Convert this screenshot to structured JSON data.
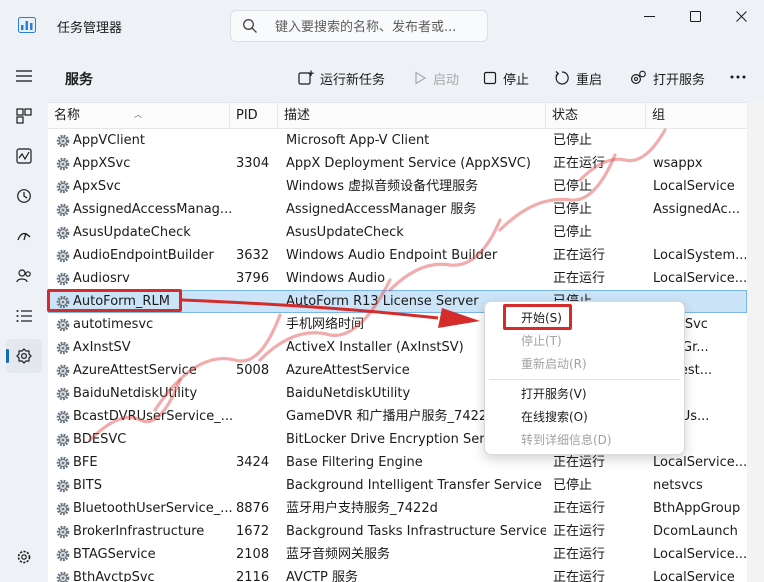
{
  "titlebar": {
    "app_title": "任务管理器",
    "search_placeholder": "键入要搜索的名称、发布者或...",
    "icons": [
      "task-manager-logo-icon",
      "search-icon",
      "minimize-icon",
      "maximize-icon",
      "close-icon"
    ]
  },
  "nav": {
    "items": [
      "hamburger-menu-icon",
      "processes-icon",
      "performance-icon",
      "app-history-icon",
      "startup-apps-icon",
      "users-icon",
      "details-icon",
      "services-icon",
      "settings-icon"
    ],
    "active": "services-icon"
  },
  "toolbar": {
    "title": "服务",
    "run_new_task": "运行新任务",
    "start": "启动",
    "stop": "停止",
    "restart": "重启",
    "open_services": "打开服务"
  },
  "table": {
    "headers": {
      "name": "名称",
      "pid": "PID",
      "desc": "描述",
      "status": "状态",
      "group": "组"
    },
    "rows": [
      {
        "name": "AppVClient",
        "pid": "",
        "desc": "Microsoft App-V Client",
        "status": "已停止",
        "group": ""
      },
      {
        "name": "AppXSvc",
        "pid": "3304",
        "desc": "AppX Deployment Service (AppXSVC)",
        "status": "正在运行",
        "group": "wsappx"
      },
      {
        "name": "ApxSvc",
        "pid": "",
        "desc": "Windows 虚拟音频设备代理服务",
        "status": "已停止",
        "group": "LocalService"
      },
      {
        "name": "AssignedAccessManag...",
        "pid": "",
        "desc": "AssignedAccessManager 服务",
        "status": "已停止",
        "group": "AssignedAc..."
      },
      {
        "name": "AsusUpdateCheck",
        "pid": "",
        "desc": "AsusUpdateCheck",
        "status": "已停止",
        "group": ""
      },
      {
        "name": "AudioEndpointBuilder",
        "pid": "3632",
        "desc": "Windows Audio Endpoint Builder",
        "status": "正在运行",
        "group": "LocalSystem..."
      },
      {
        "name": "Audiosrv",
        "pid": "3796",
        "desc": "Windows Audio",
        "status": "正在运行",
        "group": "LocalService..."
      },
      {
        "name": "AutoForm_RLM",
        "pid": "",
        "desc": "AutoForm R13 License Server",
        "status": "已停止",
        "group": ""
      },
      {
        "name": "autotimesvc",
        "pid": "",
        "desc": "手机网络时间",
        "status": "",
        "group": "TimeSvc"
      },
      {
        "name": "AxInstSV",
        "pid": "",
        "desc": "ActiveX Installer (AxInstSV)",
        "status": "",
        "group": "stSVGr..."
      },
      {
        "name": "AzureAttestService",
        "pid": "5008",
        "desc": "AzureAttestService",
        "status": "",
        "group": "eAttest..."
      },
      {
        "name": "BaiduNetdiskUtility",
        "pid": "",
        "desc": "BaiduNetdiskUtility",
        "status": "",
        "group": ""
      },
      {
        "name": "BcastDVRUserService_...",
        "pid": "",
        "desc": "GameDVR 和广播用户服务_7422d",
        "status": "",
        "group": "DVRUs..."
      },
      {
        "name": "BDESVC",
        "pid": "",
        "desc": "BitLocker Drive Encryption Servi",
        "status": "",
        "group": "cs"
      },
      {
        "name": "BFE",
        "pid": "3424",
        "desc": "Base Filtering Engine",
        "status": "正在运行",
        "group": "LocalService..."
      },
      {
        "name": "BITS",
        "pid": "",
        "desc": "Background Intelligent Transfer Service",
        "status": "已停止",
        "group": "netsvcs"
      },
      {
        "name": "BluetoothUserService_...",
        "pid": "8876",
        "desc": "蓝牙用户支持服务_7422d",
        "status": "正在运行",
        "group": "BthAppGroup"
      },
      {
        "name": "BrokerInfrastructure",
        "pid": "1672",
        "desc": "Background Tasks Infrastructure Service",
        "status": "正在运行",
        "group": "DcomLaunch"
      },
      {
        "name": "BTAGService",
        "pid": "2108",
        "desc": "蓝牙音频网关服务",
        "status": "正在运行",
        "group": "LocalService..."
      },
      {
        "name": "BthAvctpSvc",
        "pid": "2116",
        "desc": "AVCTP 服务",
        "status": "正在运行",
        "group": "LocalService"
      }
    ]
  },
  "context_menu": {
    "items": [
      {
        "label": "开始(S)",
        "enabled": true
      },
      {
        "label": "停止(T)",
        "enabled": false
      },
      {
        "label": "重新启动(R)",
        "enabled": false
      },
      {
        "label": "打开服务(V)",
        "enabled": true
      },
      {
        "label": "在线搜索(O)",
        "enabled": true
      },
      {
        "label": "转到详细信息(D)",
        "enabled": false
      }
    ]
  },
  "colors": {
    "accent": "#0f6cbd",
    "selection": "#cce4f7",
    "annotation_red": "#d62b2b"
  }
}
